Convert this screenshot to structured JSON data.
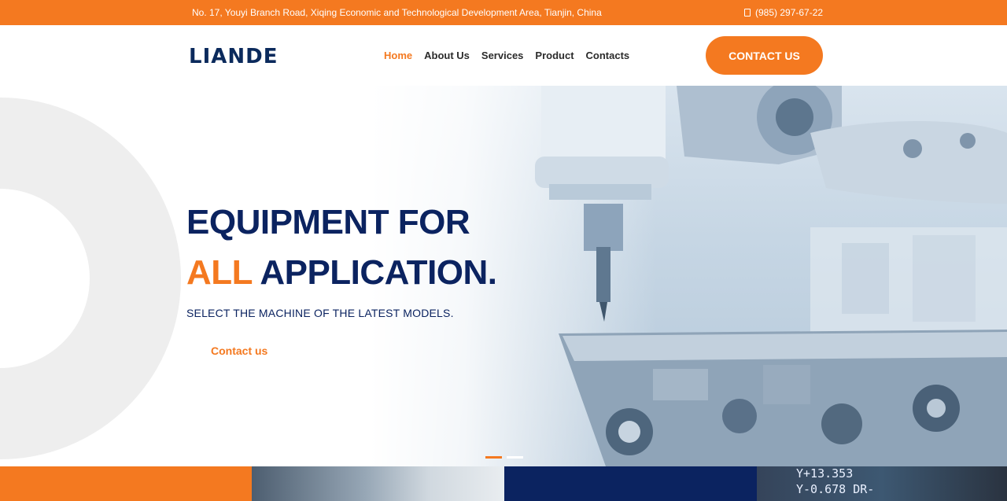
{
  "topbar": {
    "address": "No. 17, Youyi Branch Road, Xiqing Economic and Technological Development Area, Tianjin, China",
    "phone": "(985) 297-67-22"
  },
  "header": {
    "logo": "LIANDE",
    "nav": [
      {
        "label": "Home",
        "active": true
      },
      {
        "label": "About Us"
      },
      {
        "label": "Services"
      },
      {
        "label": "Product"
      },
      {
        "label": "Contacts"
      }
    ],
    "cta": "CONTACT US"
  },
  "hero": {
    "line1": "EQUIPMENT FOR",
    "line2_accent": "ALL",
    "line2_rest": "APPLICATION.",
    "subline": "SELECT THE MACHINE OF THE LATEST MODELS.",
    "link": "Contact us",
    "slides": 2,
    "active_slide": 1
  },
  "strip": {
    "readout_1": "Y+13.353",
    "readout_2": "Y-0.678  DR-"
  },
  "colors": {
    "accent": "#f47920",
    "navy": "#0b2360"
  }
}
